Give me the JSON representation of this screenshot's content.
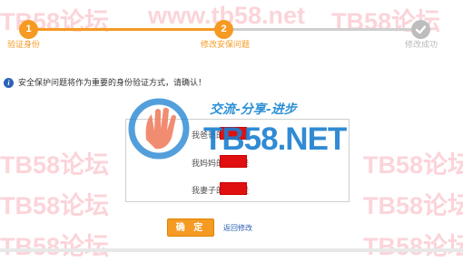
{
  "stepper": {
    "steps": [
      {
        "number": "1",
        "label": "验证身份",
        "state": "done"
      },
      {
        "number": "2",
        "label": "修改安保问题",
        "state": "current"
      },
      {
        "number": "",
        "label": "修改成功",
        "state": "pending"
      }
    ]
  },
  "notice": {
    "icon": "info-icon",
    "text": "安全保护问题将作为重要的身份验证方式，请确认！"
  },
  "questions": [
    {
      "label": "我爸爸的名字是",
      "value": ""
    },
    {
      "label": "我妈妈的名字是",
      "value": ""
    },
    {
      "label": "我妻子的名字是",
      "value": ""
    }
  ],
  "actions": {
    "confirm_label": "确 定",
    "back_label": "返回修改"
  },
  "watermark": {
    "text": "TB58论坛：www.tb58.net",
    "short": "TB58论坛",
    "logo_text": "TB58.NET",
    "slogan": "交流-分享-进步"
  },
  "colors": {
    "accent": "#f59a23",
    "inactive": "#bdbdbd",
    "answer_fill": "#e01010",
    "link": "#2a5db0"
  }
}
